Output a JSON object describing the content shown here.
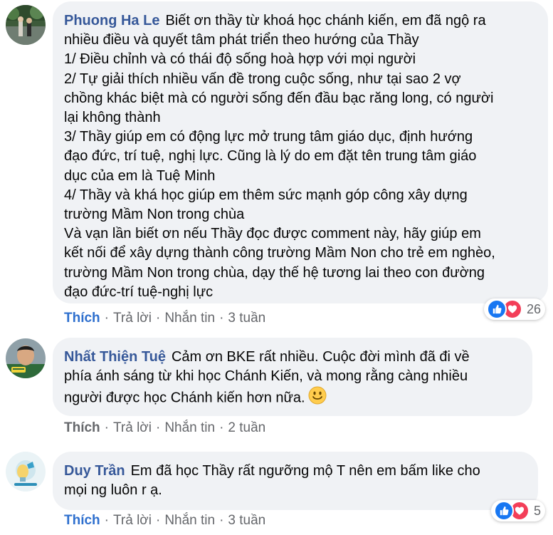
{
  "comments": [
    {
      "author": "Phuong Ha Le",
      "lines": [
        "Biết ơn thầy từ khoá học chánh kiến, em đã ngộ ra",
        "nhiều điều và quyết tâm phát triển theo hướng của Thầy",
        "1/ Điều chỉnh và có thái độ sống hoà hợp với mọi người",
        "2/ Tự giải thích nhiều vấn đề trong cuộc sống, như tại sao 2 vợ",
        "chồng khác biệt mà có người sống đến đầu bạc răng long, có người",
        "lại không thành",
        "3/ Thầy giúp em có động lực mở trung tâm giáo dục, định hướng",
        "đạo đức, trí tuệ, nghị lực. Cũng là lý do em đặt tên trung tâm giáo",
        "dục của em là Tuệ Minh",
        "4/ Thầy và khá học giúp em thêm sức mạnh góp công xây dựng",
        "trường Mầm Non trong chùa",
        "Và vạn lần biết ơn nếu Thầy đọc được comment này, hãy giúp em",
        "kết nối để xây dựng thành công trường Mầm Non cho trẻ em nghèo,",
        "trường Mầm Non trong chùa, dạy thế hệ tương lai theo con đường",
        "đạo đức-trí tuệ-nghị lực"
      ],
      "actions": {
        "like": "Thích",
        "reply": "Trả lời",
        "message": "Nhắn tin",
        "time": "3 tuần"
      },
      "reaction_count": "26",
      "like_active": true
    },
    {
      "author": "Nhất Thiện Tuệ",
      "lines": [
        "Cảm ơn BKE rất nhiều. Cuộc đời mình đã đi về",
        "phía ánh sáng từ khi học Chánh Kiến, và mong rằng càng nhiều",
        "người được học Chánh kiến hơn nữa."
      ],
      "emoji": "smiley-face",
      "actions": {
        "like": "Thích",
        "reply": "Trả lời",
        "message": "Nhắn tin",
        "time": "2 tuần"
      },
      "like_active": false
    },
    {
      "author": "Duy Trần",
      "lines": [
        "Em đã học Thầy rất ngưỡng mộ T nên em bấm like cho",
        "mọi ng luôn r ạ."
      ],
      "actions": {
        "like": "Thích",
        "reply": "Trả lời",
        "message": "Nhắn tin",
        "time": "3 tuần"
      },
      "reaction_count": "5",
      "like_active": true
    }
  ],
  "colors": {
    "author": "#365899",
    "like_active": "#2e6fce",
    "bubble": "#f0f2f5",
    "meta": "#65676b"
  },
  "separator": "·"
}
